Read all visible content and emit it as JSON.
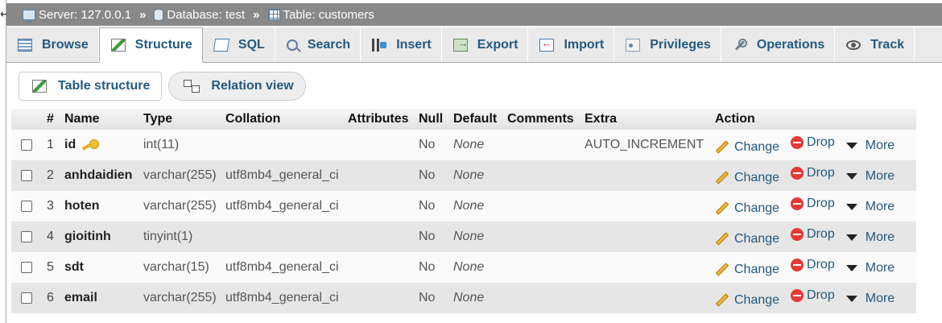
{
  "breadcrumb": {
    "server": "Server: 127.0.0.1",
    "database": "Database: test",
    "table": "Table: customers",
    "separator": "»"
  },
  "tabs": [
    {
      "label": "Browse",
      "icon": "browse-icon",
      "active": false
    },
    {
      "label": "Structure",
      "icon": "structure-icon",
      "active": true
    },
    {
      "label": "SQL",
      "icon": "sql-icon",
      "active": false
    },
    {
      "label": "Search",
      "icon": "search-icon",
      "active": false
    },
    {
      "label": "Insert",
      "icon": "insert-icon",
      "active": false
    },
    {
      "label": "Export",
      "icon": "export-icon",
      "active": false
    },
    {
      "label": "Import",
      "icon": "import-icon",
      "active": false
    },
    {
      "label": "Privileges",
      "icon": "privileges-icon",
      "active": false
    },
    {
      "label": "Operations",
      "icon": "operations-icon",
      "active": false
    },
    {
      "label": "Track",
      "icon": "tracking-icon",
      "active": false
    }
  ],
  "subtabs": {
    "table_structure": "Table structure",
    "relation_view": "Relation view"
  },
  "table": {
    "headers": {
      "num": "#",
      "name": "Name",
      "type": "Type",
      "collation": "Collation",
      "attributes": "Attributes",
      "null": "Null",
      "default": "Default",
      "comments": "Comments",
      "extra": "Extra",
      "action": "Action"
    },
    "actions": {
      "change": "Change",
      "drop": "Drop",
      "more": "More"
    },
    "rows": [
      {
        "num": "1",
        "name": "id",
        "type": "int(11)",
        "collation": "",
        "attributes": "",
        "null": "No",
        "default": "None",
        "comments": "",
        "extra": "AUTO_INCREMENT",
        "primary_key": true
      },
      {
        "num": "2",
        "name": "anhdaidien",
        "type": "varchar(255)",
        "collation": "utf8mb4_general_ci",
        "attributes": "",
        "null": "No",
        "default": "None",
        "comments": "",
        "extra": ""
      },
      {
        "num": "3",
        "name": "hoten",
        "type": "varchar(255)",
        "collation": "utf8mb4_general_ci",
        "attributes": "",
        "null": "No",
        "default": "None",
        "comments": "",
        "extra": ""
      },
      {
        "num": "4",
        "name": "gioitinh",
        "type": "tinyint(1)",
        "collation": "",
        "attributes": "",
        "null": "No",
        "default": "None",
        "comments": "",
        "extra": ""
      },
      {
        "num": "5",
        "name": "sdt",
        "type": "varchar(15)",
        "collation": "utf8mb4_general_ci",
        "attributes": "",
        "null": "No",
        "default": "None",
        "comments": "",
        "extra": ""
      },
      {
        "num": "6",
        "name": "email",
        "type": "varchar(255)",
        "collation": "utf8mb4_general_ci",
        "attributes": "",
        "null": "No",
        "default": "None",
        "comments": "",
        "extra": ""
      }
    ]
  }
}
